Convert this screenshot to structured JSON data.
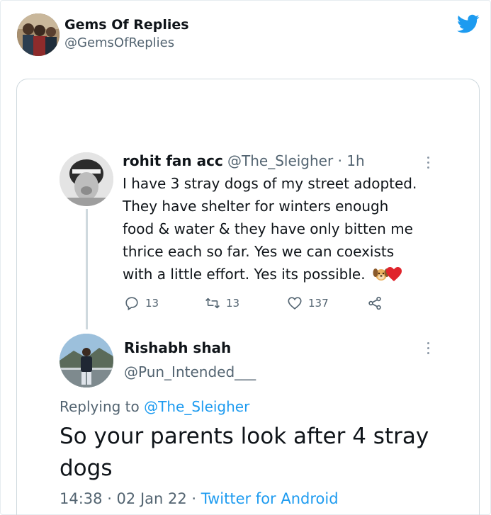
{
  "embed": {
    "account_name": "Gems Of Replies",
    "account_handle": "@GemsOfReplies",
    "logo": "twitter-bird-icon"
  },
  "colors": {
    "accent": "#1d9bf0",
    "secondary_text": "#536471",
    "border": "#cfd9de"
  },
  "parent_tweet": {
    "name": "rohit fan acc",
    "handle_time": "@The_Sleigher · 1h",
    "lines": [
      "I have 3 stray dogs of my street adopted.",
      "They have shelter for winters enough",
      "food & water & they have only bitten me",
      "thrice each so far. Yes we can coexists",
      "with a little effort. Yes its possible."
    ],
    "emojis": [
      "dog-face-emoji",
      "red-heart-emoji"
    ],
    "replies": "13",
    "retweets": "13",
    "likes": "137"
  },
  "reply_tweet": {
    "name": "Rishabh shah",
    "handle": "@Pun_Intended___",
    "replying_prefix": "Replying to ",
    "replying_mention": "@The_Sleigher",
    "lines": [
      "So your parents look after 4 stray",
      "dogs"
    ],
    "time_date": "14:38 · 02 Jan 22 · ",
    "source": "Twitter for Android"
  }
}
